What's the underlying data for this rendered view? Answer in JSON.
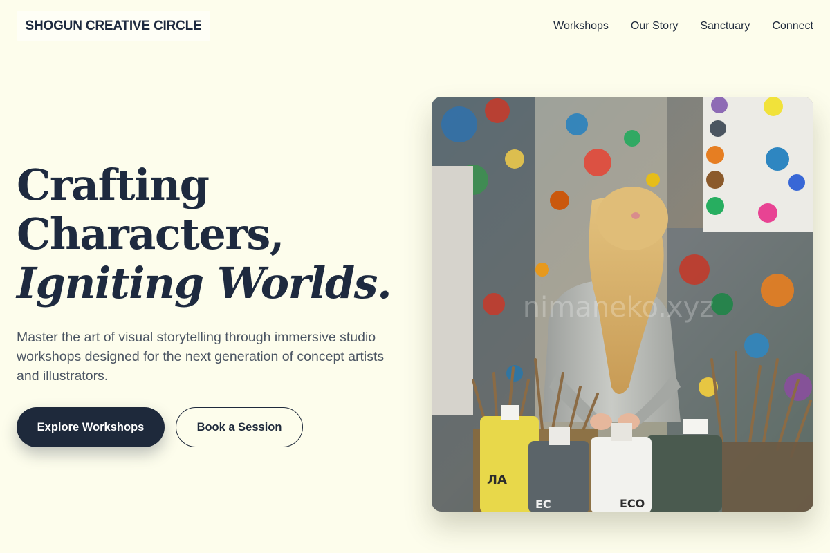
{
  "header": {
    "logo": "SHOGUN CREATIVE CIRCLE",
    "nav": [
      {
        "label": "Workshops"
      },
      {
        "label": "Our Story"
      },
      {
        "label": "Sanctuary"
      },
      {
        "label": "Connect"
      }
    ]
  },
  "hero": {
    "title_line1": "Crafting",
    "title_line2": "Characters,",
    "title_line3": "Igniting Worlds.",
    "subtitle": "Master the art of visual storytelling through immersive studio workshops designed for the next generation of concept artists and illustrators.",
    "primary_button": "Explore Workshops",
    "secondary_button": "Book a Session",
    "image": {
      "watermark": "nimaneko.xyz",
      "bottle_labels": [
        "ЛA",
        "EC",
        "ECO"
      ]
    }
  },
  "colors": {
    "background": "#fdfdec",
    "primary": "#1e293b",
    "text_muted": "#4b5563"
  }
}
